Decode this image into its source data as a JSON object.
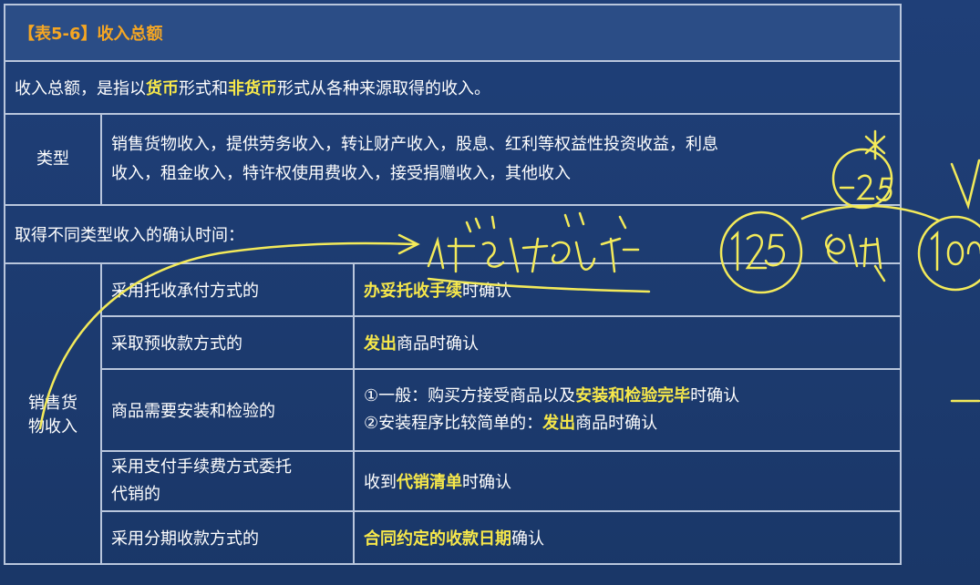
{
  "title": "【表5-6】收入总额",
  "intro": {
    "p1": "收入总额，是指以",
    "h1": "货币",
    "p2": "形式和",
    "h2": "非货币",
    "p3": "形式从各种来源取得的收入。"
  },
  "types": {
    "label": "类型",
    "line1": "销售货物收入，提供劳务收入，转让财产收入，股息、红利等权益性投资收益，利息",
    "line2": "收入，租金收入，特许权使用费收入，接受捐赠收入，其他收入"
  },
  "timing_heading": "取得不同类型收入的确认时间：",
  "sales_label": {
    "l1": "销售货",
    "l2": "物收入"
  },
  "rows": [
    {
      "method": "采用托收承付方式的",
      "hl": "办妥托收手续",
      "rest": "时确认"
    },
    {
      "method": "采取预收款方式的",
      "hl": "发出",
      "rest": "商品时确认"
    },
    {
      "method": "商品需要安装和检验的",
      "a1": "①一般：购买方接受商品以及",
      "ahl": "安装和检验完毕",
      "a2": "时确认",
      "b1": "②安装程序比较简单的：",
      "bhl": "发出",
      "b2": "商品时确认"
    },
    {
      "m1": "采用支付手续费方式委托",
      "m2": "代销的",
      "pre": "收到",
      "hl": "代销清单",
      "rest": "时确认"
    },
    {
      "method": "采用分期收款方式的",
      "hl": "合同约定的收款日期",
      "rest": "确认"
    }
  ]
}
